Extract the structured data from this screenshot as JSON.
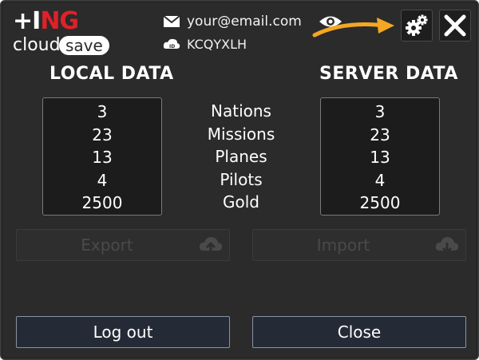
{
  "logo": {
    "brand_prefix": "+I",
    "brand_red": "NG",
    "cloud_word": "cloud",
    "save_word": "save"
  },
  "account": {
    "email": "your@email.com",
    "code": "KCQYXLH"
  },
  "columns": {
    "local_title": "LOCAL DATA",
    "server_title": "SERVER DATA"
  },
  "labels": [
    "Nations",
    "Missions",
    "Planes",
    "Pilots",
    "Gold"
  ],
  "local_values": [
    "3",
    "23",
    "13",
    "4",
    "2500"
  ],
  "server_values": [
    "3",
    "23",
    "13",
    "4",
    "2500"
  ],
  "buttons": {
    "export": "Export",
    "import": "Import",
    "logout": "Log out",
    "close": "Close"
  },
  "icons": {
    "email": "envelope-icon",
    "id": "id-card-icon",
    "eye": "eye-icon",
    "arrow": "arrow-icon",
    "settings": "gears-icon",
    "close": "close-icon",
    "cloud": "cloud-upload-icon"
  },
  "colors": {
    "background": "#2b2b2b",
    "arrow": "#f5a623",
    "brand_red": "#e0202a",
    "button": "#252b36"
  }
}
